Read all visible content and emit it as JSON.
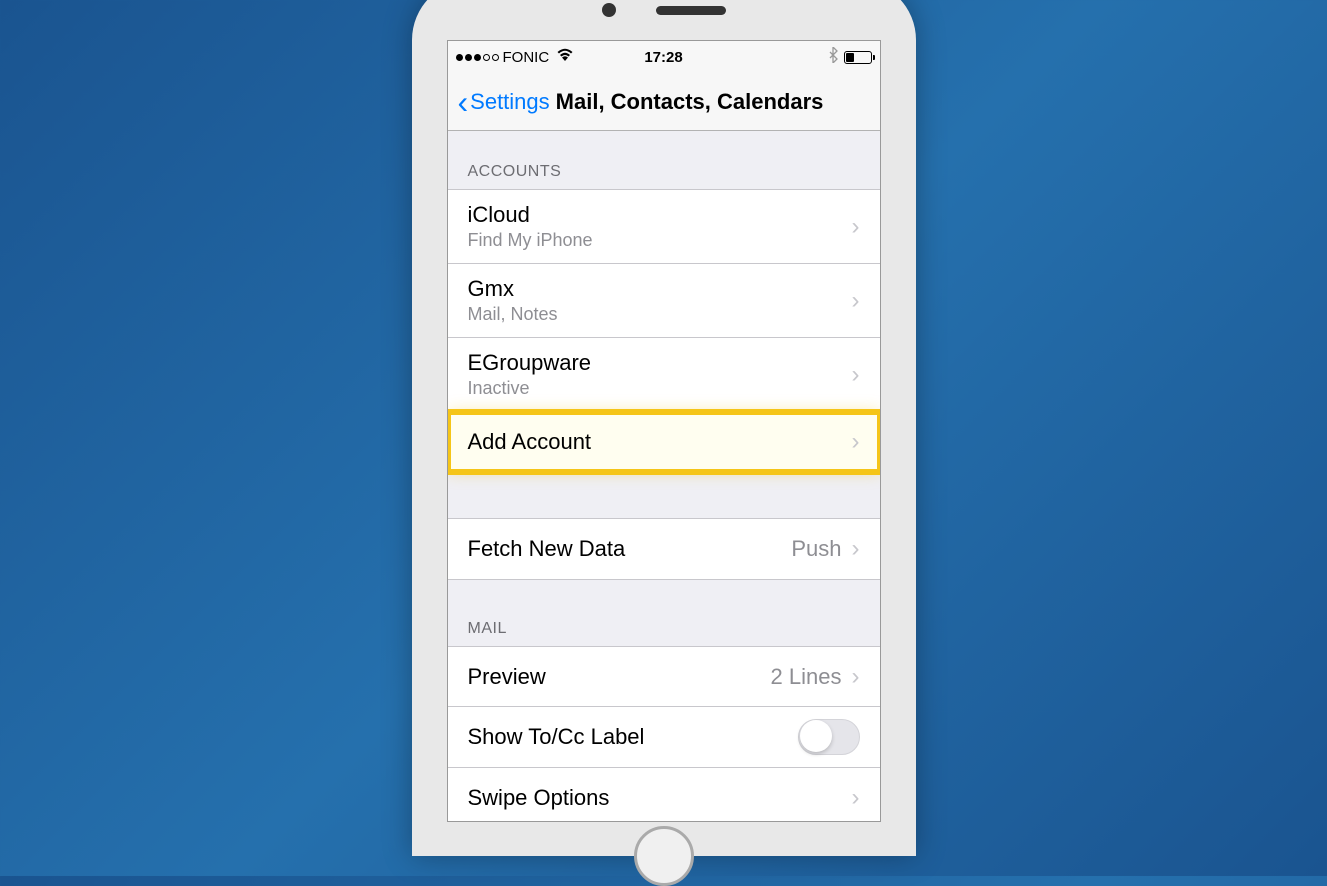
{
  "statusBar": {
    "carrier": "FONIC",
    "time": "17:28"
  },
  "navBar": {
    "backLabel": "Settings",
    "title": "Mail, Contacts, Calendars"
  },
  "sections": {
    "accounts": {
      "header": "ACCOUNTS",
      "items": [
        {
          "title": "iCloud",
          "subtitle": "Find My iPhone"
        },
        {
          "title": "Gmx",
          "subtitle": "Mail, Notes"
        },
        {
          "title": "EGroupware",
          "subtitle": "Inactive"
        }
      ],
      "addAccount": "Add Account"
    },
    "fetch": {
      "label": "Fetch New Data",
      "value": "Push"
    },
    "mail": {
      "header": "MAIL",
      "preview": {
        "label": "Preview",
        "value": "2 Lines"
      },
      "showToCc": {
        "label": "Show To/Cc Label"
      },
      "swipeOptions": {
        "label": "Swipe Options"
      }
    }
  }
}
